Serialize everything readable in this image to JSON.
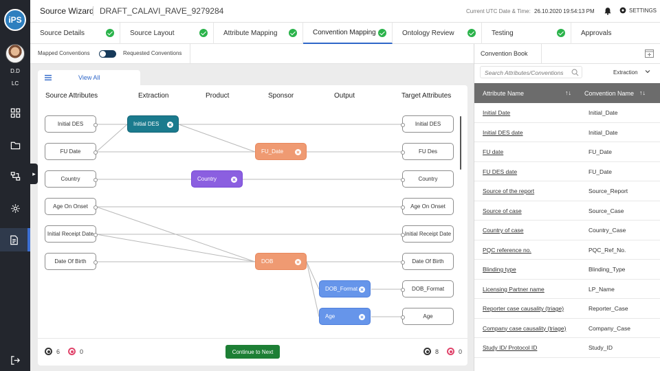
{
  "app": {
    "logo_text": "iPS",
    "title": "Source Wizard",
    "document_name": "DRAFT_CALAVI_RAVE_9279284",
    "utc_label": "Current UTC Date & Time:",
    "utc_value": "26.10.2020 19:54:13 PM",
    "settings_label": "SETTINGS",
    "user_initials_1": "D.D",
    "user_initials_2": "LC"
  },
  "steps": [
    {
      "label": "Source Details",
      "done": true
    },
    {
      "label": "Source Layout",
      "done": true
    },
    {
      "label": "Attribute Mapping",
      "done": true
    },
    {
      "label": "Convention Mapping",
      "done": true
    },
    {
      "label": "Ontology Review",
      "done": true
    },
    {
      "label": "Testing",
      "done": true
    },
    {
      "label": "Approvals",
      "done": false
    }
  ],
  "toggle": {
    "mapped_label": "Mapped Conventions",
    "requested_label": "Requested Conventions"
  },
  "canvas": {
    "view_all_label": "View All",
    "columns": [
      "Source Attributes",
      "Extraction",
      "Product",
      "Sponsor",
      "Output",
      "Target Attributes"
    ],
    "source_nodes": [
      "Initial DES",
      "FU Date",
      "Country",
      "Age On Onset",
      "Initial Receipt Date",
      "Date Of Birth"
    ],
    "target_nodes": [
      "Initial DES",
      "FU Des",
      "Country",
      "Age On Onset",
      "Initial Receipt Date",
      "Date Of Birth",
      "DOB_Format",
      "Age"
    ],
    "convention_chips": [
      "Initial DES",
      "FU_Date",
      "Country",
      "DOB",
      "DOB_Format",
      "Age"
    ],
    "footer": {
      "left_count_a": "6",
      "left_count_b": "0",
      "continue_label": "Continue to Next",
      "right_count_a": "8",
      "right_count_b": "0"
    }
  },
  "convention_book": {
    "tab_label": "Convention Book",
    "search_placeholder": "Search Attributes/Conventions",
    "filter_value": "Extraction",
    "col_attribute": "Attribute Name",
    "col_convention": "Convention Name",
    "sort_glyph": "↑↓",
    "rows": [
      {
        "attribute": "Initial Date",
        "convention": "Initial_Date"
      },
      {
        "attribute": "Initial DES date",
        "convention": "Initial_Date"
      },
      {
        "attribute": "FU date",
        "convention": "FU_Date"
      },
      {
        "attribute": "FU DES date",
        "convention": "FU_Date"
      },
      {
        "attribute": "Source of the report",
        "convention": "Source_Report"
      },
      {
        "attribute": "Source of case",
        "convention": "Source_Case"
      },
      {
        "attribute": "Country of case",
        "convention": "Country_Case"
      },
      {
        "attribute": "PQC reference no.",
        "convention": "PQC_Ref_No."
      },
      {
        "attribute": "Blinding type",
        "convention": "Blinding_Type"
      },
      {
        "attribute": "Licensing Partner name",
        "convention": "LP_Name"
      },
      {
        "attribute": "Reporter case causality (triage)",
        "convention": "Reporter_Case"
      },
      {
        "attribute": "Company case causality (triage)",
        "convention": "Company_Case"
      },
      {
        "attribute": "Study ID/ Protocol ID",
        "convention": "Study_ID"
      }
    ]
  },
  "colors": {
    "accent": "#2e66c8",
    "success": "#2bb34b",
    "teal_chip": "#1b7b8e",
    "orange_chip": "#ef9a72",
    "purple_chip": "#8b5fe0",
    "blue_chip": "#6695ea",
    "continue_button": "#1d7f35"
  }
}
